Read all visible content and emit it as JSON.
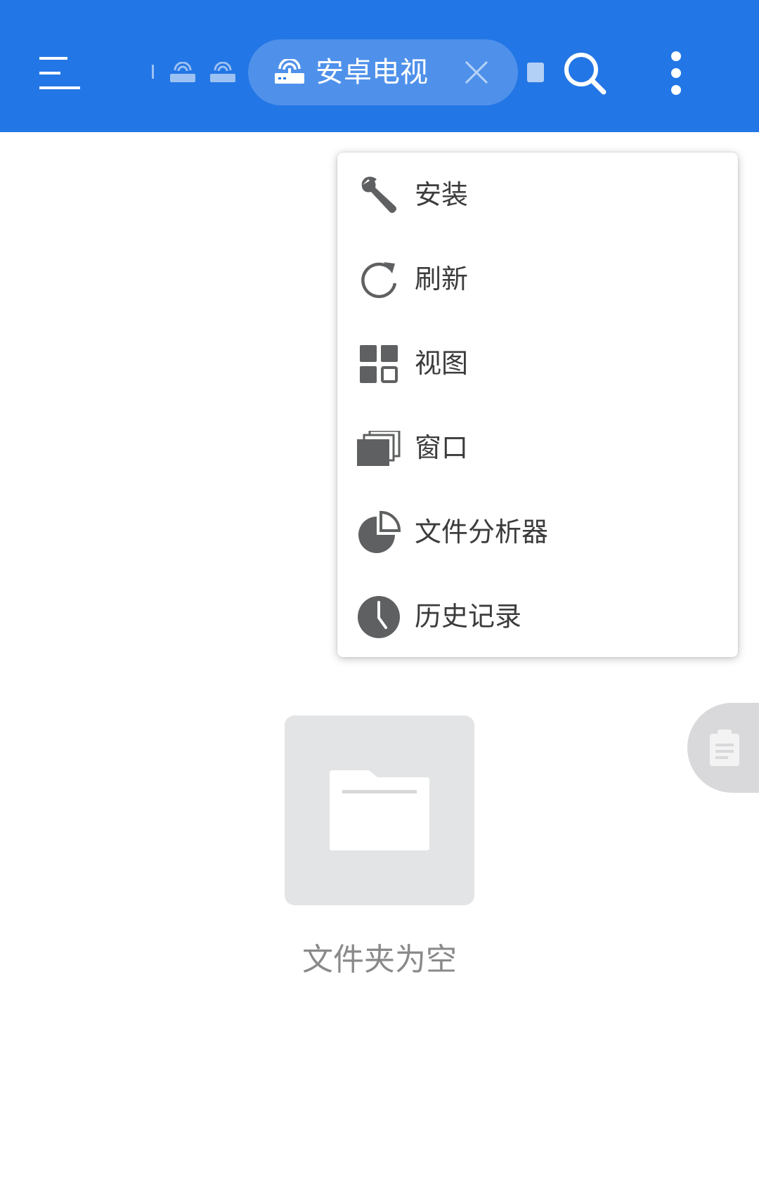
{
  "appbar": {
    "background": "#2376E5",
    "menu_icon": "hamburger-menu-icon",
    "active_tab": {
      "label": "安卓电视",
      "icon": "router-icon",
      "close_icon": "close-icon"
    },
    "search_icon": "search-icon",
    "more_icon": "more-vert-icon"
  },
  "popup_menu": {
    "items": [
      {
        "label": "安装",
        "icon": "wrench-icon"
      },
      {
        "label": "刷新",
        "icon": "refresh-icon"
      },
      {
        "label": "视图",
        "icon": "grid-view-icon"
      },
      {
        "label": "窗口",
        "icon": "windows-stack-icon"
      },
      {
        "label": "文件分析器",
        "icon": "pie-chart-icon"
      },
      {
        "label": "历史记录",
        "icon": "clock-icon"
      }
    ]
  },
  "empty_state": {
    "icon": "folder-icon",
    "message": "文件夹为空"
  },
  "clipboard_tab": {
    "icon": "clipboard-icon"
  }
}
